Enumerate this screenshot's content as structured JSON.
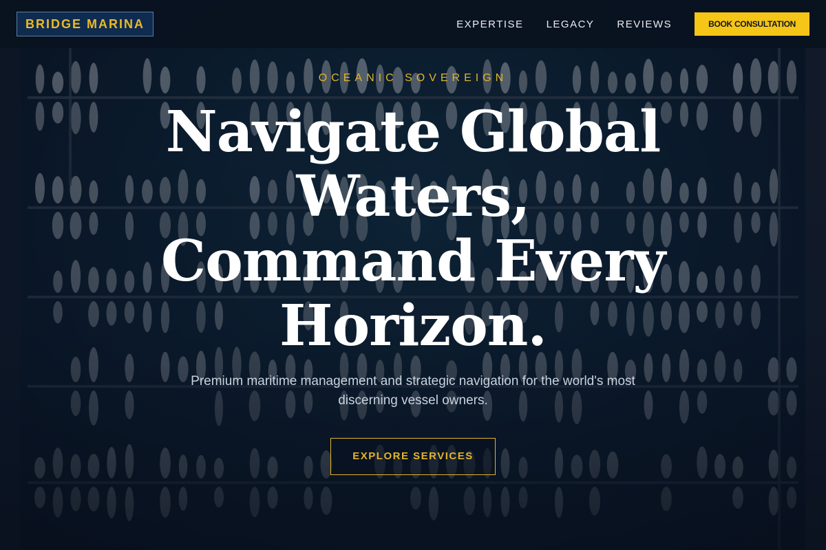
{
  "header": {
    "logo": "BRIDGE MARINA",
    "nav": [
      {
        "label": "EXPERTISE"
      },
      {
        "label": "LEGACY"
      },
      {
        "label": "REVIEWS"
      }
    ],
    "cta_label": "BOOK CONSULTATION"
  },
  "hero": {
    "eyebrow": "OCEANIC SOVEREIGN",
    "headline": "Navigate Global Waters, Command Every Horizon.",
    "subtitle": "Premium maritime management and strategic navigation for the world's most discerning vessel owners.",
    "button_label": "EXPLORE SERVICES",
    "background_image": "aerial-marina-photo"
  },
  "colors": {
    "accent": "#f5c518",
    "gold_text": "#e2b52a",
    "header_bg": "#0a1220",
    "logo_bg": "#0f2b4f"
  }
}
